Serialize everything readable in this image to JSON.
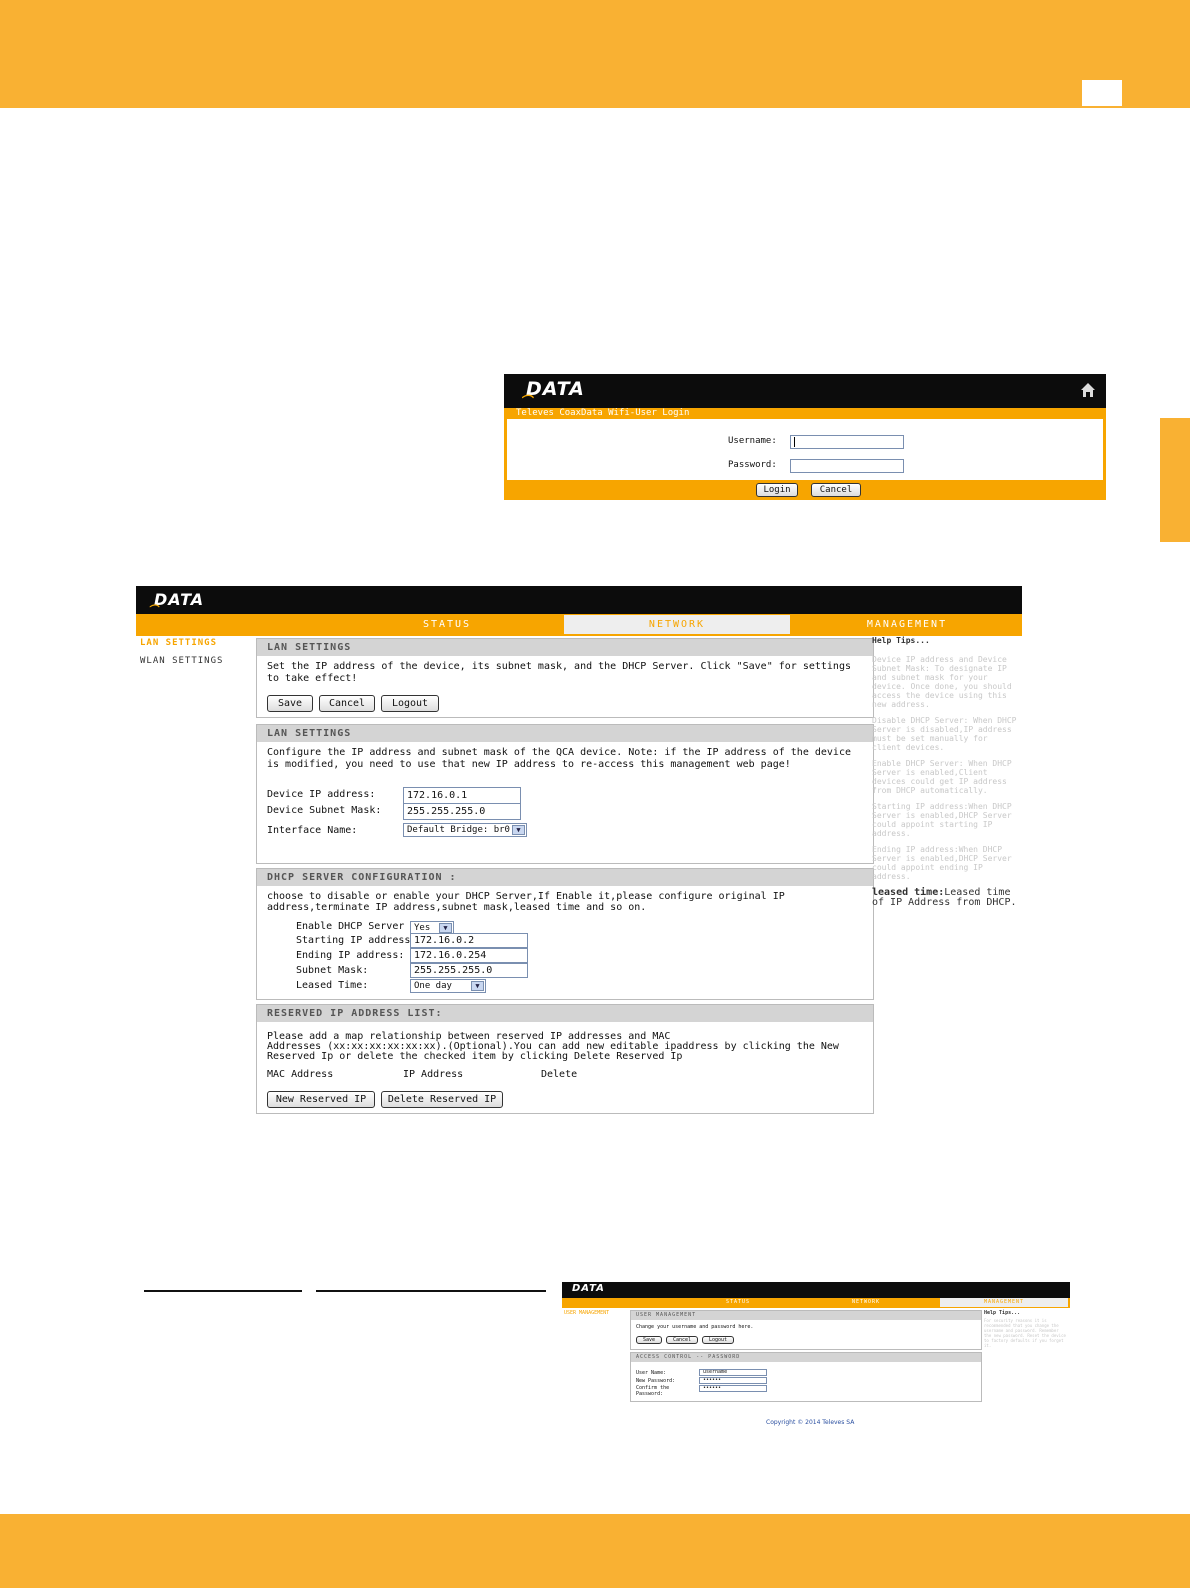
{
  "page": {
    "colors": {
      "accent": "#f9b133",
      "bar": "#f7a500",
      "header": "#0c0c0c"
    }
  },
  "login": {
    "logo": "DATA",
    "home_icon": "home-icon",
    "title": "Televes CoaxData Wifi-User Login",
    "username_label": "Username:",
    "password_label": "Password:",
    "login_button": "Login",
    "cancel_button": "Cancel"
  },
  "network": {
    "logo": "DATA",
    "nav": {
      "status": "STATUS",
      "network": "NETWORK",
      "management": "MANAGEMENT"
    },
    "sidebar": {
      "lan": "LAN SETTINGS",
      "wlan": "WLAN SETTINGS"
    },
    "sec1": {
      "title": "LAN SETTINGS",
      "desc": "Set the IP address of the device, its subnet mask, and the DHCP Server. Click \"Save\" for settings to take effect!",
      "save": "Save",
      "cancel": "Cancel",
      "logout": "Logout"
    },
    "sec2": {
      "title": "LAN SETTINGS",
      "desc": "Configure the IP address and subnet mask of the QCA device. Note: if the IP address of the device is modified, you need to use that new IP address to re-access this management web page!",
      "ip_label": "Device IP address:",
      "ip_value": "172.16.0.1",
      "mask_label": "Device Subnet Mask:",
      "mask_value": "255.255.255.0",
      "iface_label": "Interface Name:",
      "iface_value": "Default Bridge: br0"
    },
    "sec3": {
      "title": "DHCP SERVER CONFIGURATION :",
      "desc": "choose to disable or enable your DHCP Server,If Enable it,please configure original IP address,terminate IP address,subnet mask,leased time and so on.",
      "enable_label": "Enable DHCP Server",
      "enable_value": "Yes",
      "start_label": "Starting IP address:",
      "start_value": "172.16.0.2",
      "end_label": "Ending IP address:",
      "end_value": "172.16.0.254",
      "mask_label": "Subnet Mask:",
      "mask_value": "255.255.255.0",
      "lease_label": "Leased Time:",
      "lease_value": "One day"
    },
    "sec4": {
      "title": "RESERVED IP ADDRESS LIST:",
      "desc1": "Please add a map relationship between reserved IP addresses and MAC",
      "desc2": "Addresses (xx:xx:xx:xx:xx:xx).(Optional).You can add new editable ipaddress by clicking the New",
      "desc3": "Reserved Ip or delete the checked item by clicking Delete Reserved Ip",
      "col_mac": "MAC Address",
      "col_ip": "IP Address",
      "col_delete": "Delete",
      "new_btn": "New Reserved IP",
      "delete_btn": "Delete Reserved IP"
    },
    "help": {
      "title": "Help Tips...",
      "t1": "Device IP address and Device Subnet Mask: To designate IP and subnet mask for your device. Once done, you should access the device using this new address.",
      "t2": "Disable DHCP Server: When DHCP Server is disabled,IP address must be set manually for client devices.",
      "t3": "Enable DHCP Server: When DHCP Server is enabled,Client devices could get IP address from DHCP automatically.",
      "t4": "Starting IP address:When DHCP Server is enabled,DHCP Server could appoint starting IP address.",
      "t5": "Ending IP address:When DHCP Server is enabled,DHCP Server could appoint ending IP address.",
      "leased_bold": "leased time:",
      "leased_text": "Leased time of IP Address from DHCP."
    }
  },
  "mgmt": {
    "logo": "DATA",
    "nav": {
      "status": "STATUS",
      "network": "NETWORK",
      "management": "MANAGEMENT"
    },
    "sidebar": "USER MANAGEMENT",
    "sec1": {
      "title": "USER MANAGEMENT",
      "desc": "Change your username and password here.",
      "save": "Save",
      "cancel": "Cancel",
      "logout": "Logout"
    },
    "sec2": {
      "title": "ACCESS CONTROL -- PASSWORD",
      "user_label": "User Name:",
      "user_value": "username",
      "newpw_label": "New Password:",
      "newpw_value": "••••••",
      "confirm_label1": "Confirm the",
      "confirm_label2": "Password:",
      "confirm_value": "••••••"
    },
    "help_title": "Help Tips...",
    "help_text": "For security reasons it is recommended that you change the username and password. Remember the new password. Reset the device to factory defaults if you forget it.",
    "copyright": "Copyright © 2014 Televes SA"
  }
}
